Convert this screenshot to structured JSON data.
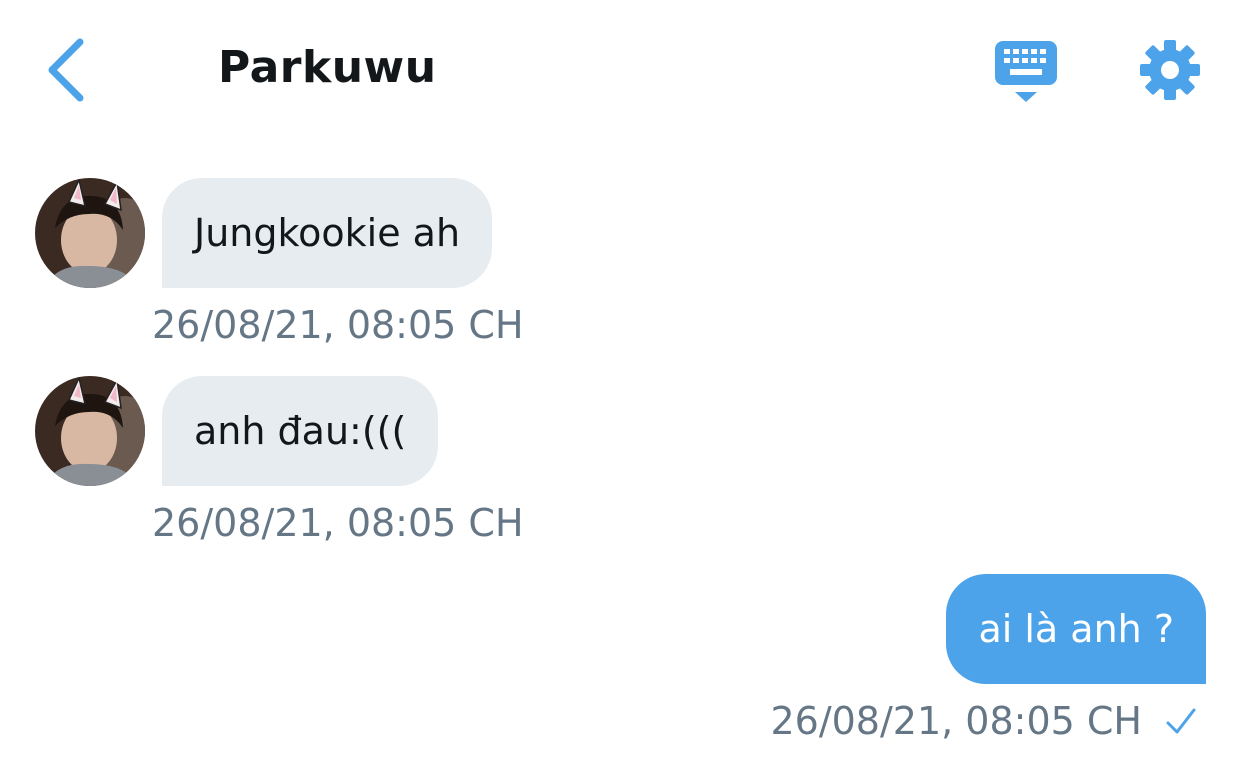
{
  "header": {
    "title": "Parkuwu",
    "back_icon": "chevron-left-icon",
    "keyboard_icon": "keyboard-icon",
    "settings_icon": "gear-icon"
  },
  "colors": {
    "accent": "#4da3ea",
    "incoming_bubble": "#e6ecf0",
    "timestamp": "#657786",
    "title": "#14171a"
  },
  "messages": [
    {
      "direction": "incoming",
      "text": "Jungkookie ah",
      "timestamp": "26/08/21, 08:05 CH"
    },
    {
      "direction": "incoming",
      "text": "anh đau:(((",
      "timestamp": "26/08/21, 08:05 CH"
    },
    {
      "direction": "outgoing",
      "text": "ai là anh ?",
      "timestamp": "26/08/21, 08:05 CH",
      "status_icon": "check-icon"
    }
  ]
}
